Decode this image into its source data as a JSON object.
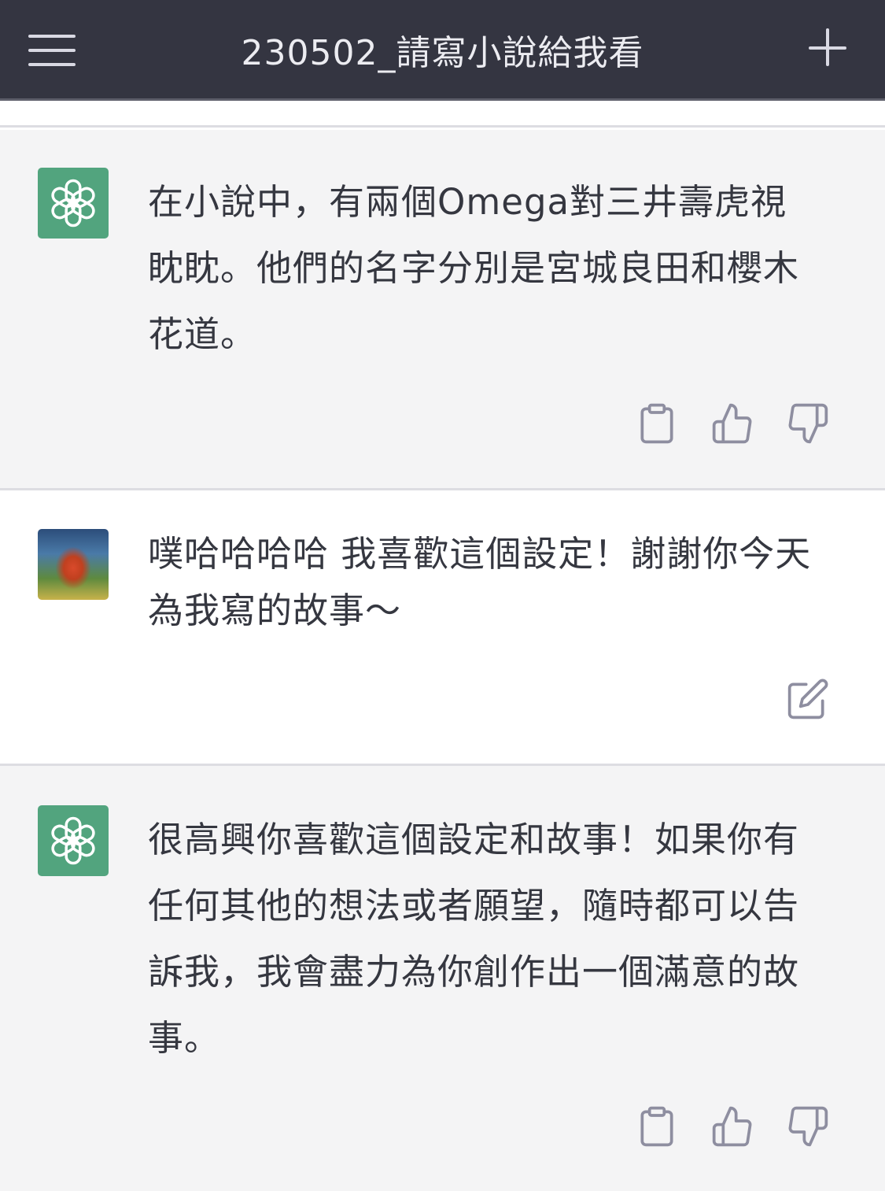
{
  "header": {
    "title": "230502_請寫小說給我看"
  },
  "messages": [
    {
      "role": "assistant",
      "text": "在小說中，有兩個Omega對三井壽虎視眈眈。他們的名字分別是宮城良田和櫻木花道。"
    },
    {
      "role": "user",
      "text": "噗哈哈哈哈 我喜歡這個設定！謝謝你今天為我寫的故事～"
    },
    {
      "role": "assistant",
      "text": "很高興你喜歡這個設定和故事！如果你有任何其他的想法或者願望，隨時都可以告訴我，我會盡力為你創作出一個滿意的故事。"
    }
  ],
  "icons": {
    "menu": "hamburger-menu-icon",
    "new_chat": "plus-icon",
    "copy": "clipboard-icon",
    "like": "thumbs-up-icon",
    "dislike": "thumbs-down-icon",
    "edit": "edit-icon",
    "assistant_avatar": "openai-logo-icon"
  },
  "colors": {
    "topbar": "#343541",
    "assistant_bg": "#f4f4f5",
    "user_bg": "#ffffff",
    "assistant_avatar": "#52a47e",
    "text": "#353740",
    "icon": "#8e8ea0"
  }
}
